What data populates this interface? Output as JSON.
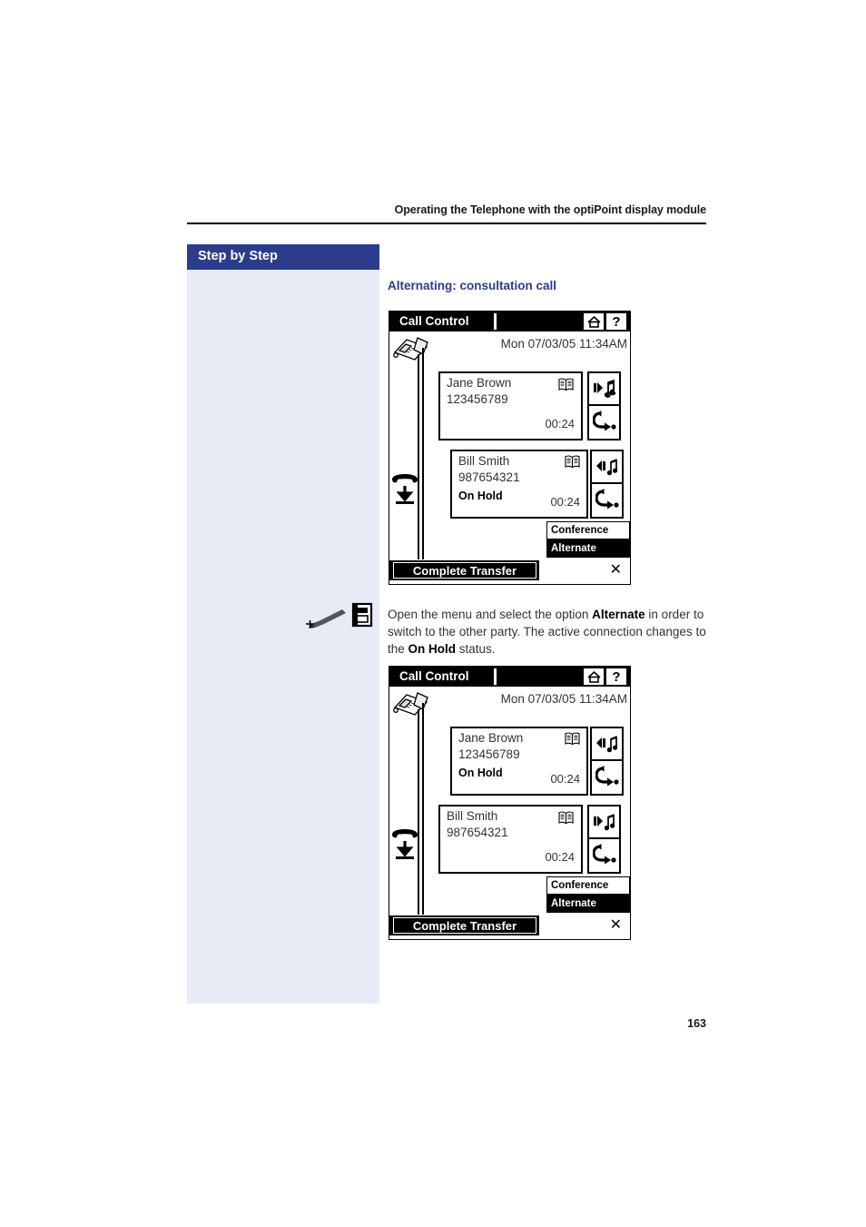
{
  "header": {
    "running_head": "Operating the Telephone with the optiPoint display module"
  },
  "sidebar": {
    "title": "Step by Step"
  },
  "section": {
    "heading": "Alternating: consultation call"
  },
  "instruction": {
    "icons": [
      "stylus-icon",
      "menu-icon"
    ],
    "text_html": "Open the menu and select the option <b>Alternate</b> in order to switch to the other party. The active connection changes to the <b>On Hold</b> status.",
    "text_plain": "Open the menu and select the option Alternate in order to switch to the other party. The active connection changes to the On Hold status."
  },
  "displays": [
    {
      "id": "display-before",
      "titlebar": {
        "title": "Call Control",
        "home_icon": "home-icon",
        "help_icon": "question-mark-icon"
      },
      "clock": "Mon 07/03/05 11:34AM",
      "phone_icon": "desk-phone-icon",
      "hangup_icon": "handset-down-icon",
      "parties": [
        {
          "name": "Jane Brown",
          "number": "123456789",
          "status": "",
          "timer": "00:24",
          "directory_icon": "open-book-icon",
          "actions": [
            "hold-music-right-icon",
            "transfer-arrow-icon"
          ]
        },
        {
          "name": "Bill Smith",
          "number": "987654321",
          "status": "On Hold",
          "timer": "00:24",
          "directory_icon": "open-book-icon",
          "actions": [
            "hold-music-left-icon",
            "transfer-arrow-icon"
          ]
        }
      ],
      "menu": [
        {
          "label": "Conference",
          "selected": false
        },
        {
          "label": "Alternate",
          "selected": true
        }
      ],
      "bottom": {
        "label": "Complete Transfer",
        "close_icon": "close-x-icon"
      }
    },
    {
      "id": "display-after",
      "titlebar": {
        "title": "Call Control",
        "home_icon": "home-icon",
        "help_icon": "question-mark-icon"
      },
      "clock": "Mon 07/03/05 11:34AM",
      "phone_icon": "desk-phone-icon",
      "hangup_icon": "handset-down-icon",
      "parties": [
        {
          "name": "Jane Brown",
          "number": "123456789",
          "status": "On Hold",
          "timer": "00:24",
          "directory_icon": "open-book-icon",
          "actions": [
            "hold-music-left-icon",
            "transfer-arrow-icon"
          ]
        },
        {
          "name": "Bill Smith",
          "number": "987654321",
          "status": "",
          "timer": "00:24",
          "directory_icon": "open-book-icon",
          "actions": [
            "hold-music-right-icon",
            "transfer-arrow-icon"
          ]
        }
      ],
      "menu": [
        {
          "label": "Conference",
          "selected": false
        },
        {
          "label": "Alternate",
          "selected": true
        }
      ],
      "bottom": {
        "label": "Complete Transfer",
        "close_icon": "close-x-icon"
      }
    }
  ],
  "footer": {
    "page_number": "163"
  },
  "colors": {
    "sidebar_header": "#2c3c8c",
    "sidebar_body": "#e7ebf6",
    "heading": "#2c3c8c",
    "lcd_bg": "#ffffff",
    "lcd_fg": "#000000"
  }
}
